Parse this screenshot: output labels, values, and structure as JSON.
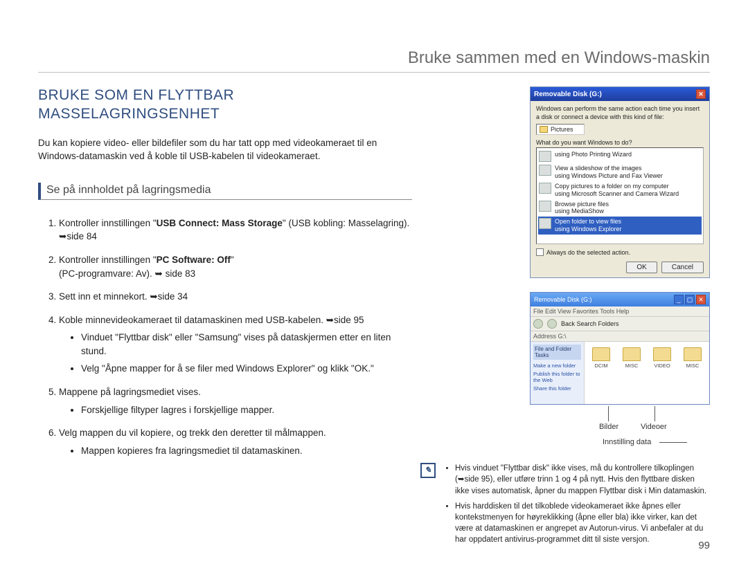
{
  "header": {
    "running_title": "Bruke sammen med en Windows-maskin"
  },
  "heading": "BRUKE SOM EN FLYTTBAR MASSELAGRINGSENHET",
  "intro": "Du kan kopiere video- eller bildefiler som du har tatt opp med videokameraet til en Windows-datamaskin ved å koble til USB-kabelen til videokameraet.",
  "subheading": "Se på innholdet på lagringsmedia",
  "steps": {
    "s1_a": "Kontroller innstillingen \"",
    "s1_bold": "USB Connect: Mass Storage",
    "s1_b": "\" (USB kobling: Masselagring). ",
    "s1_ref": "side 84",
    "s2_a": "Kontroller innstillingen \"",
    "s2_bold": "PC Software: Off",
    "s2_b": "\"",
    "s2_line2": "(PC-programvare: Av). ",
    "s2_ref": "side 83",
    "s3": "Sett inn et minnekort. ",
    "s3_ref": "side 34",
    "s4": "Koble minnevideokameraet til datamaskinen med USB-kabelen. ",
    "s4_ref": "side 95",
    "s4_b1": "Vinduet \"Flyttbar disk\" eller \"Samsung\" vises på dataskjermen etter en liten stund.",
    "s4_b2": "Velg \"Åpne mapper for å se filer med Windows Explorer\" og klikk \"OK.\"",
    "s5": "Mappene på lagringsmediet vises.",
    "s5_b1": "Forskjellige filtyper lagres i forskjellige mapper.",
    "s6": "Velg mappen du vil kopiere, og trekk den deretter til målmappen.",
    "s6_b1": "Mappen kopieres fra lagringsmediet til datamaskinen."
  },
  "dialog": {
    "title": "Removable Disk (G:)",
    "desc": "Windows can perform the same action each time you insert a disk or connect a device with this kind of file:",
    "pictures": "Pictures",
    "prompt": "What do you want Windows to do?",
    "options": [
      {
        "line1": "using Photo Printing Wizard"
      },
      {
        "line1": "View a slideshow of the images",
        "line2": "using Windows Picture and Fax Viewer"
      },
      {
        "line1": "Copy pictures to a folder on my computer",
        "line2": "using Microsoft Scanner and Camera Wizard"
      },
      {
        "line1": "Browse picture files",
        "line2": "using MediaShow"
      },
      {
        "line1": "Open folder to view files",
        "line2": "using Windows Explorer",
        "selected": true
      }
    ],
    "always": "Always do the selected action.",
    "ok": "OK",
    "cancel": "Cancel"
  },
  "explorer": {
    "title": "Removable Disk (G:)",
    "menu": "File   Edit   View   Favorites   Tools   Help",
    "tools": "Back      Search   Folders",
    "address": "Address   G:\\",
    "side_head": "File and Folder Tasks",
    "side_links": [
      "Make a new folder",
      "Publish this folder to the Web",
      "Share this folder"
    ],
    "folders": [
      "DCIM",
      "MISC",
      "VIDEO",
      "MISC"
    ]
  },
  "callouts": {
    "bilder": "Bilder",
    "videoer": "Videoer",
    "innstilling": "Innstilling data"
  },
  "notes": {
    "n1_a": "Hvis vinduet \"Flyttbar disk\" ikke vises, må du kontrollere tilkoplingen (",
    "n1_ref": "side 95",
    "n1_b": "), eller utføre trinn 1 og 4 på nytt. Hvis den flyttbare disken ikke vises automatisk, åpner du mappen Flyttbar disk i Min datamaskin.",
    "n2": "Hvis harddisken til det tilkoblede videokameraet ikke åpnes eller kontekstmenyen for høyreklikking (åpne eller bla) ikke virker, kan det være at datamaskinen er angrepet av Autorun-virus. Vi anbefaler at du har oppdatert antivirus-programmet ditt til siste versjon."
  },
  "page_number": "99",
  "glyphs": {
    "arrow": "➥"
  }
}
